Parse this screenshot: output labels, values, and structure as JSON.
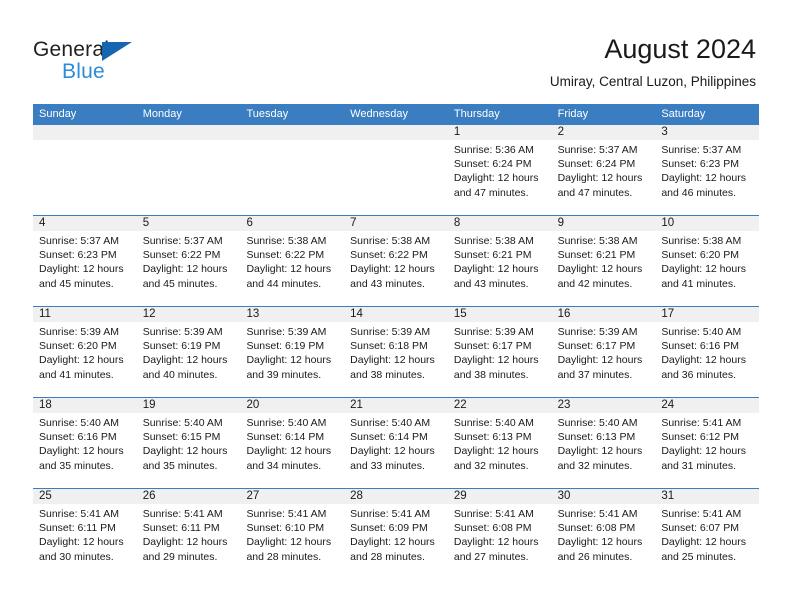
{
  "brand": {
    "name_top": "General",
    "name_bottom": "Blue",
    "accent_color": "#2e8bd8",
    "triangle_color": "#1565b0"
  },
  "header": {
    "title": "August 2024",
    "location": "Umiray, Central Luzon, Philippines"
  },
  "calendar": {
    "header_bg": "#3a7dc0",
    "day_band_bg": "#f0f0f0",
    "weekdays": [
      "Sunday",
      "Monday",
      "Tuesday",
      "Wednesday",
      "Thursday",
      "Friday",
      "Saturday"
    ],
    "weeks": [
      [
        {
          "empty": true
        },
        {
          "empty": true
        },
        {
          "empty": true
        },
        {
          "empty": true
        },
        {
          "day": "1",
          "sunrise": "Sunrise: 5:36 AM",
          "sunset": "Sunset: 6:24 PM",
          "daylight": "Daylight: 12 hours and 47 minutes."
        },
        {
          "day": "2",
          "sunrise": "Sunrise: 5:37 AM",
          "sunset": "Sunset: 6:24 PM",
          "daylight": "Daylight: 12 hours and 47 minutes."
        },
        {
          "day": "3",
          "sunrise": "Sunrise: 5:37 AM",
          "sunset": "Sunset: 6:23 PM",
          "daylight": "Daylight: 12 hours and 46 minutes."
        }
      ],
      [
        {
          "day": "4",
          "sunrise": "Sunrise: 5:37 AM",
          "sunset": "Sunset: 6:23 PM",
          "daylight": "Daylight: 12 hours and 45 minutes."
        },
        {
          "day": "5",
          "sunrise": "Sunrise: 5:37 AM",
          "sunset": "Sunset: 6:22 PM",
          "daylight": "Daylight: 12 hours and 45 minutes."
        },
        {
          "day": "6",
          "sunrise": "Sunrise: 5:38 AM",
          "sunset": "Sunset: 6:22 PM",
          "daylight": "Daylight: 12 hours and 44 minutes."
        },
        {
          "day": "7",
          "sunrise": "Sunrise: 5:38 AM",
          "sunset": "Sunset: 6:22 PM",
          "daylight": "Daylight: 12 hours and 43 minutes."
        },
        {
          "day": "8",
          "sunrise": "Sunrise: 5:38 AM",
          "sunset": "Sunset: 6:21 PM",
          "daylight": "Daylight: 12 hours and 43 minutes."
        },
        {
          "day": "9",
          "sunrise": "Sunrise: 5:38 AM",
          "sunset": "Sunset: 6:21 PM",
          "daylight": "Daylight: 12 hours and 42 minutes."
        },
        {
          "day": "10",
          "sunrise": "Sunrise: 5:38 AM",
          "sunset": "Sunset: 6:20 PM",
          "daylight": "Daylight: 12 hours and 41 minutes."
        }
      ],
      [
        {
          "day": "11",
          "sunrise": "Sunrise: 5:39 AM",
          "sunset": "Sunset: 6:20 PM",
          "daylight": "Daylight: 12 hours and 41 minutes."
        },
        {
          "day": "12",
          "sunrise": "Sunrise: 5:39 AM",
          "sunset": "Sunset: 6:19 PM",
          "daylight": "Daylight: 12 hours and 40 minutes."
        },
        {
          "day": "13",
          "sunrise": "Sunrise: 5:39 AM",
          "sunset": "Sunset: 6:19 PM",
          "daylight": "Daylight: 12 hours and 39 minutes."
        },
        {
          "day": "14",
          "sunrise": "Sunrise: 5:39 AM",
          "sunset": "Sunset: 6:18 PM",
          "daylight": "Daylight: 12 hours and 38 minutes."
        },
        {
          "day": "15",
          "sunrise": "Sunrise: 5:39 AM",
          "sunset": "Sunset: 6:17 PM",
          "daylight": "Daylight: 12 hours and 38 minutes."
        },
        {
          "day": "16",
          "sunrise": "Sunrise: 5:39 AM",
          "sunset": "Sunset: 6:17 PM",
          "daylight": "Daylight: 12 hours and 37 minutes."
        },
        {
          "day": "17",
          "sunrise": "Sunrise: 5:40 AM",
          "sunset": "Sunset: 6:16 PM",
          "daylight": "Daylight: 12 hours and 36 minutes."
        }
      ],
      [
        {
          "day": "18",
          "sunrise": "Sunrise: 5:40 AM",
          "sunset": "Sunset: 6:16 PM",
          "daylight": "Daylight: 12 hours and 35 minutes."
        },
        {
          "day": "19",
          "sunrise": "Sunrise: 5:40 AM",
          "sunset": "Sunset: 6:15 PM",
          "daylight": "Daylight: 12 hours and 35 minutes."
        },
        {
          "day": "20",
          "sunrise": "Sunrise: 5:40 AM",
          "sunset": "Sunset: 6:14 PM",
          "daylight": "Daylight: 12 hours and 34 minutes."
        },
        {
          "day": "21",
          "sunrise": "Sunrise: 5:40 AM",
          "sunset": "Sunset: 6:14 PM",
          "daylight": "Daylight: 12 hours and 33 minutes."
        },
        {
          "day": "22",
          "sunrise": "Sunrise: 5:40 AM",
          "sunset": "Sunset: 6:13 PM",
          "daylight": "Daylight: 12 hours and 32 minutes."
        },
        {
          "day": "23",
          "sunrise": "Sunrise: 5:40 AM",
          "sunset": "Sunset: 6:13 PM",
          "daylight": "Daylight: 12 hours and 32 minutes."
        },
        {
          "day": "24",
          "sunrise": "Sunrise: 5:41 AM",
          "sunset": "Sunset: 6:12 PM",
          "daylight": "Daylight: 12 hours and 31 minutes."
        }
      ],
      [
        {
          "day": "25",
          "sunrise": "Sunrise: 5:41 AM",
          "sunset": "Sunset: 6:11 PM",
          "daylight": "Daylight: 12 hours and 30 minutes."
        },
        {
          "day": "26",
          "sunrise": "Sunrise: 5:41 AM",
          "sunset": "Sunset: 6:11 PM",
          "daylight": "Daylight: 12 hours and 29 minutes."
        },
        {
          "day": "27",
          "sunrise": "Sunrise: 5:41 AM",
          "sunset": "Sunset: 6:10 PM",
          "daylight": "Daylight: 12 hours and 28 minutes."
        },
        {
          "day": "28",
          "sunrise": "Sunrise: 5:41 AM",
          "sunset": "Sunset: 6:09 PM",
          "daylight": "Daylight: 12 hours and 28 minutes."
        },
        {
          "day": "29",
          "sunrise": "Sunrise: 5:41 AM",
          "sunset": "Sunset: 6:08 PM",
          "daylight": "Daylight: 12 hours and 27 minutes."
        },
        {
          "day": "30",
          "sunrise": "Sunrise: 5:41 AM",
          "sunset": "Sunset: 6:08 PM",
          "daylight": "Daylight: 12 hours and 26 minutes."
        },
        {
          "day": "31",
          "sunrise": "Sunrise: 5:41 AM",
          "sunset": "Sunset: 6:07 PM",
          "daylight": "Daylight: 12 hours and 25 minutes."
        }
      ]
    ]
  }
}
